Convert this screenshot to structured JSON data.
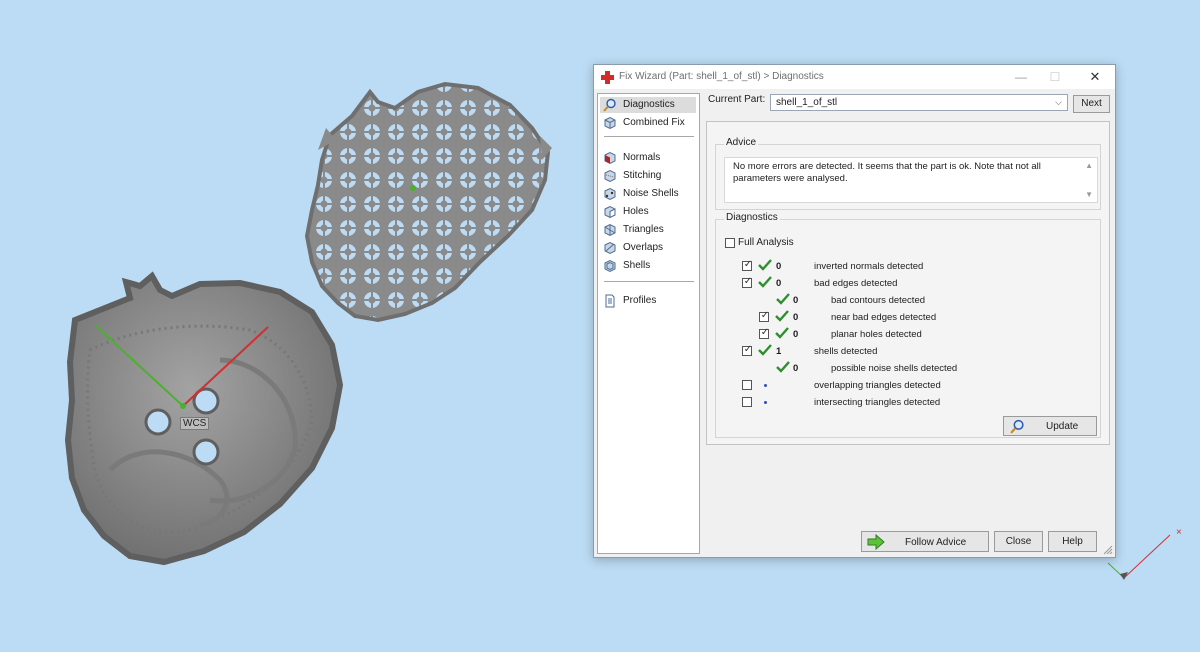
{
  "colors": {
    "background": "#bcdcf5",
    "model": "#8a8a8a",
    "check_green": "#2f8f2f",
    "axis_red": "#d03030",
    "axis_green": "#4caf2f",
    "dialog_bg": "#f0f0f0"
  },
  "viewport": {
    "wcs_label": "WCS"
  },
  "dialog": {
    "title": "Fix Wizard (Part: shell_1_of_stl) > Diagnostics",
    "title_icon": "red-cross-icon",
    "window_buttons": {
      "minimize": "—",
      "maximize": "☐",
      "close": "✕"
    },
    "nav": [
      {
        "label": "Diagnostics",
        "icon": "magnifier-icon",
        "selected": true
      },
      {
        "label": "Combined Fix",
        "icon": "cube-icon"
      },
      {
        "label": "Normals",
        "icon": "normals-cube-icon"
      },
      {
        "label": "Stitching",
        "icon": "stitching-cube-icon"
      },
      {
        "label": "Noise Shells",
        "icon": "noise-shells-icon"
      },
      {
        "label": "Holes",
        "icon": "holes-cube-icon"
      },
      {
        "label": "Triangles",
        "icon": "triangles-cube-icon"
      },
      {
        "label": "Overlaps",
        "icon": "overlaps-cube-icon"
      },
      {
        "label": "Shells",
        "icon": "shells-cube-icon"
      },
      {
        "label": "Profiles",
        "icon": "document-icon"
      }
    ],
    "current_part": {
      "label": "Current Part:",
      "value": "shell_1_of_stl"
    },
    "next_label": "Next",
    "advice": {
      "title": "Advice",
      "text": "No more errors are detected. It seems that the part is ok. Note that not all parameters were analysed."
    },
    "diagnostics": {
      "title": "Diagnostics",
      "full_analysis_label": "Full Analysis",
      "full_analysis_checked": false,
      "rows": [
        {
          "checked": true,
          "status": "ok",
          "count": "0",
          "label": "inverted normals detected",
          "indent": 0
        },
        {
          "checked": true,
          "status": "ok",
          "count": "0",
          "label": "bad edges detected",
          "indent": 0
        },
        {
          "checked": null,
          "status": "ok",
          "count": "0",
          "label": "bad contours detected",
          "indent": 1
        },
        {
          "checked": true,
          "status": "ok",
          "count": "0",
          "label": "near bad edges detected",
          "indent": 1
        },
        {
          "checked": true,
          "status": "ok",
          "count": "0",
          "label": "planar holes detected",
          "indent": 1
        },
        {
          "checked": true,
          "status": "ok",
          "count": "1",
          "label": "shells detected",
          "indent": 0
        },
        {
          "checked": null,
          "status": "ok",
          "count": "0",
          "label": "possible noise shells detected",
          "indent": 1
        },
        {
          "checked": false,
          "status": "not-run",
          "count": "",
          "label": "overlapping triangles detected",
          "indent": 0
        },
        {
          "checked": false,
          "status": "not-run",
          "count": "",
          "label": "intersecting triangles detected",
          "indent": 0
        }
      ],
      "update_label": "Update"
    },
    "buttons": {
      "follow_advice": "Follow Advice",
      "close": "Close",
      "help": "Help"
    }
  }
}
